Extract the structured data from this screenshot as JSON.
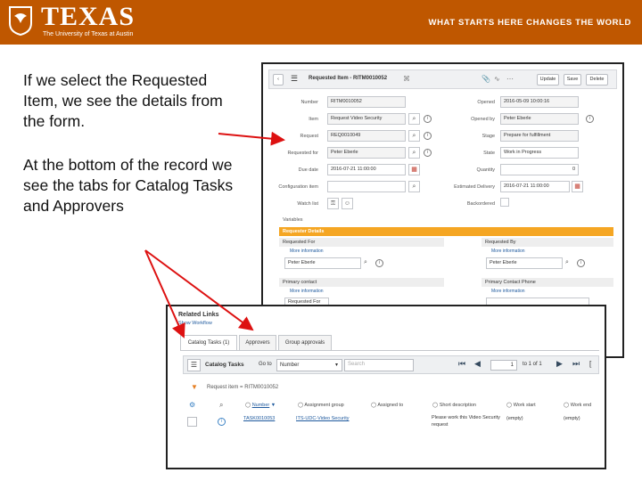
{
  "banner": {
    "logo_text": "TEXAS",
    "logo_subtitle": "The University of Texas at Austin",
    "slogan": "WHAT STARTS HERE CHANGES THE WORLD"
  },
  "text": {
    "para1": "If we select the Requested Item, we see the details from the form.",
    "para2": "At the bottom of the record we see the tabs for Catalog Tasks and Approvers"
  },
  "form": {
    "header_title": "Requested Item - RITM0010052",
    "buttons": {
      "update": "Update",
      "save": "Save",
      "delete": "Delete"
    },
    "labels": {
      "number": "Number",
      "item": "Item",
      "request": "Request",
      "requested_for": "Requested for",
      "due_date": "Due date",
      "configuration_item": "Configuration item",
      "watch_list": "Watch list",
      "opened": "Opened",
      "opened_by": "Opened by",
      "stage": "Stage",
      "state": "State",
      "quantity": "Quantity",
      "estimated_delivery": "Estimated Delivery",
      "backordered": "Backordered"
    },
    "values": {
      "number": "RITM0010052",
      "item": "Request Video Security",
      "request": "REQ0010049",
      "requested_for": "Peter Eberle",
      "due_date": "2016-07-21 11:00:00",
      "configuration_item": "",
      "opened": "2016-05-09 10:00:16",
      "opened_by": "Peter Eberle",
      "stage": "Prepare for fulfillment",
      "state": "Work in Progress",
      "quantity": "0",
      "estimated_delivery": "2016-07-21 11:00:00"
    },
    "variables": {
      "title": "Variables",
      "section": "Requester Details",
      "requested_for_label": "Requested For",
      "requested_by_label": "Requested By",
      "more_info_1": "More information",
      "more_info_2": "More information",
      "more_info_3": "More information",
      "more_info_4": "More information",
      "requested_for_value": "Peter Eberle",
      "requested_by_value": "Peter Eberle",
      "primary_contact_label": "Primary contact",
      "primary_contact_phone_label": "Primary Contact Phone",
      "primary_contact_value": "Requested For"
    }
  },
  "related": {
    "title": "Related Links",
    "subtitle": "Show Workflow",
    "tabs": [
      "Catalog Tasks (1)",
      "Approvers",
      "Group approvals"
    ],
    "toolbar": {
      "list_title": "Catalog Tasks",
      "goto": "Go to",
      "goto_select": "Number",
      "search_placeholder": "Search",
      "page_current": "1",
      "page_info": "to 1 of 1"
    },
    "filter": "Request item = RITM0010052",
    "columns": [
      "Number",
      "Assignment group",
      "Assigned to",
      "Short description",
      "Work start",
      "Work end"
    ],
    "row": {
      "number": "TASK0010053",
      "assignment_group": "ITS-UDC-Video Security",
      "short_description": "Please work this Video Security request",
      "work_start": "(empty)",
      "work_end": "(empty)"
    }
  }
}
